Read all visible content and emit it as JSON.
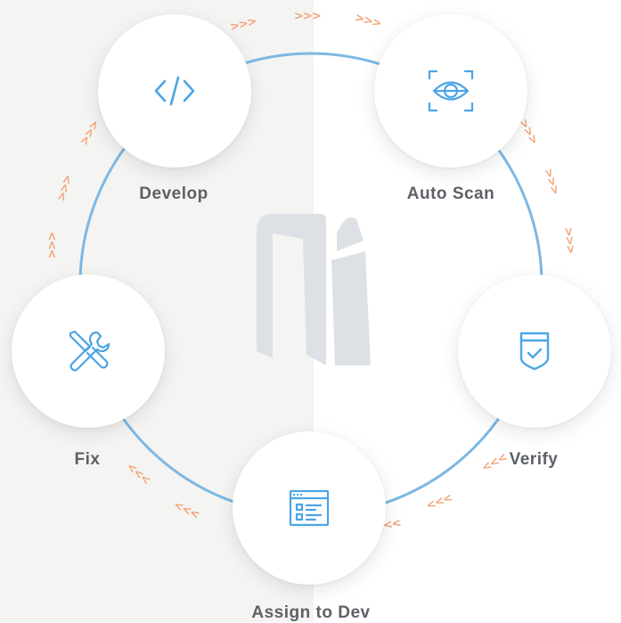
{
  "colors": {
    "ring": "#7db8e3",
    "icon": "#4aa5e6",
    "label": "#5d6166",
    "arrow": "#f2a57a",
    "logo": "#dde1e6",
    "bg_left": "#f4f4f2"
  },
  "steps": [
    {
      "key": "develop",
      "label": "Develop",
      "icon": "code-icon"
    },
    {
      "key": "auto_scan",
      "label": "Auto Scan",
      "icon": "eye-scan-icon"
    },
    {
      "key": "verify",
      "label": "Verify",
      "icon": "shield-check-icon"
    },
    {
      "key": "assign",
      "label": "Assign to Dev",
      "icon": "browser-list-icon"
    },
    {
      "key": "fix",
      "label": "Fix",
      "icon": "tools-icon"
    }
  ],
  "logo": {
    "icon": "ni-logo-mark"
  },
  "flow_arrows": {
    "top": ">>>",
    "right": ">>>",
    "bottom": "<<<",
    "left": ">>>"
  }
}
